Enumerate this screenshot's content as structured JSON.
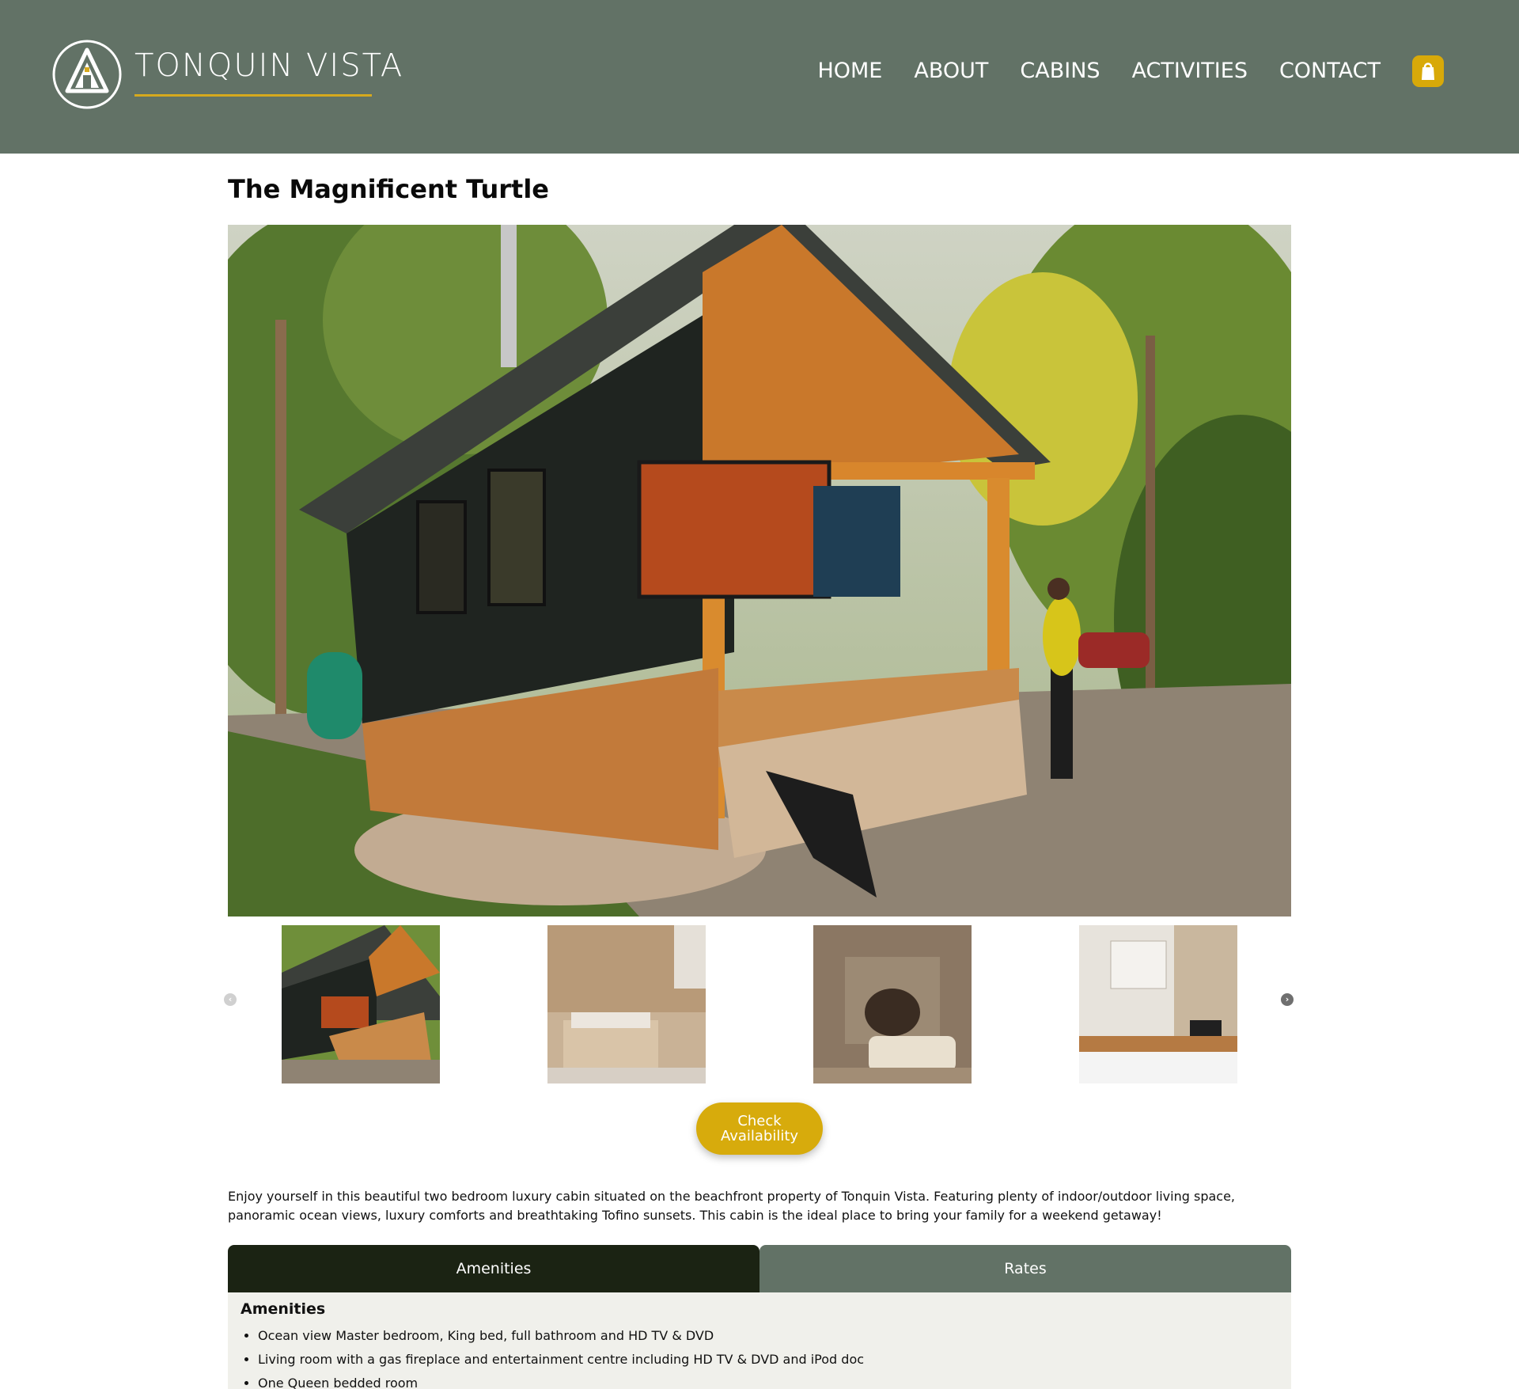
{
  "brand": {
    "name": "TONQUIN VISTA",
    "logo_icon": "a-frame-cabin-icon",
    "accent_color": "#d6a91e"
  },
  "header": {
    "background_color": "#627266"
  },
  "nav": {
    "items": [
      "HOME",
      "ABOUT",
      "CABINS",
      "ACTIVITIES",
      "CONTACT"
    ],
    "cart_icon": "shopping-bag-icon"
  },
  "cabin": {
    "title": "The Magnificent Turtle",
    "hero_image": "cabin-exterior-photo",
    "thumbnails": [
      "cabin-exterior-thumbnail",
      "bedroom-thumbnail",
      "fireplace-living-room-thumbnail",
      "kitchen-thumbnail"
    ],
    "cta_label_line1": "Check",
    "cta_label_line2": "Availability",
    "description": "Enjoy yourself in this beautiful two bedroom luxury cabin situated on the beachfront property of Tonquin Vista. Featuring plenty of indoor/outdoor living space, panoramic ocean views, luxury comforts and breathtaking Tofino sunsets. This cabin is the ideal place to bring your family for a weekend getaway!"
  },
  "tabs": [
    {
      "label": "Amenities",
      "active": true
    },
    {
      "label": "Rates",
      "active": false
    }
  ],
  "amenities": {
    "heading": "Amenities",
    "items": [
      "Ocean view Master bedroom, King bed, full bathroom and HD TV & DVD",
      "Living room with a gas fireplace and entertainment centre including HD TV & DVD and iPod doc",
      "One Queen bedded room"
    ]
  }
}
